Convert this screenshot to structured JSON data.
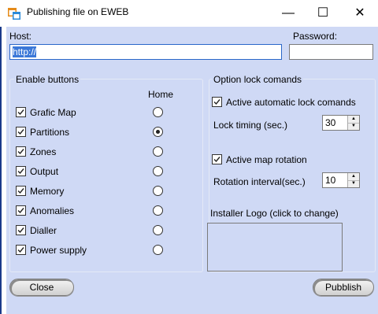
{
  "window": {
    "title": "Publishing file on EWEB",
    "minimize_glyph": "—",
    "maximize_glyph": "☐",
    "close_glyph": "✕"
  },
  "host": {
    "label": "Host:",
    "value": "http://"
  },
  "password": {
    "label": "Password:",
    "value": ""
  },
  "enable_group": {
    "title": "Enable buttons",
    "home_header": "Home",
    "items": [
      {
        "label": "Grafic Map",
        "checked": true,
        "home": false
      },
      {
        "label": "Partitions",
        "checked": true,
        "home": true
      },
      {
        "label": "Zones",
        "checked": true,
        "home": false
      },
      {
        "label": "Output",
        "checked": true,
        "home": false
      },
      {
        "label": "Memory",
        "checked": true,
        "home": false
      },
      {
        "label": "Anomalies",
        "checked": true,
        "home": false
      },
      {
        "label": "Dialler",
        "checked": true,
        "home": false
      },
      {
        "label": "Power supply",
        "checked": true,
        "home": false
      }
    ]
  },
  "lock_group": {
    "title": "Option lock comands",
    "auto_lock_label": "Active automatic lock comands",
    "lock_timing_label": "Lock timing (sec.)",
    "lock_timing_value": "30",
    "map_rotation_label": "Active map rotation",
    "rotation_interval_label": "Rotation interval(sec.)",
    "rotation_interval_value": "10"
  },
  "logo": {
    "label": "Installer Logo (click to change)"
  },
  "buttons": {
    "close": "Close",
    "publish": "Pubblish"
  },
  "icons": {
    "app": "app-window-icon",
    "spin_up": "▲",
    "spin_down": "▼"
  }
}
